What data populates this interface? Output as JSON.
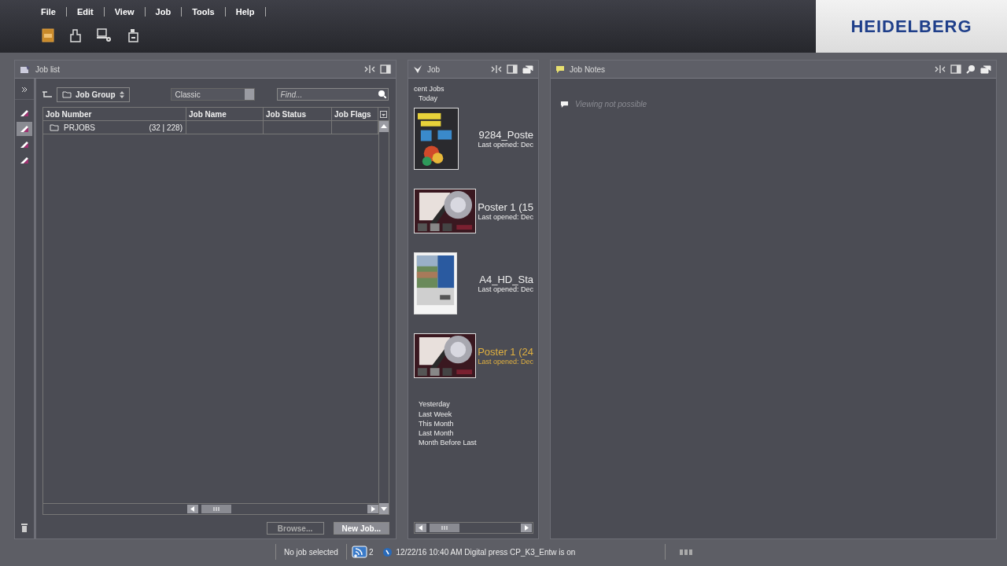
{
  "menu": [
    "File",
    "Edit",
    "View",
    "Job",
    "Tools",
    "Help"
  ],
  "logo": "HEIDELBERG",
  "job_list": {
    "title": "Job list",
    "group_selector": "Job Group",
    "view_mode": "Classic",
    "search": {
      "placeholder": "Find..."
    },
    "side_tools": [
      {
        "selected": false
      },
      {
        "selected": true
      },
      {
        "selected": false
      },
      {
        "selected": false
      }
    ],
    "columns": [
      "Job Number",
      "Job Name",
      "Job Status",
      "Job Flags"
    ],
    "rows": [
      {
        "name": "PRJOBS",
        "count": "(32 | 228)"
      }
    ],
    "buttons": [
      {
        "label": "Browse...",
        "disabled": true
      },
      {
        "label": "New Job...",
        "disabled": false
      }
    ]
  },
  "job_panel": {
    "title": "Job",
    "heading": "cent Jobs",
    "today": "Today",
    "jobs": [
      {
        "name": "9284_Poste",
        "opened": "Last opened: Dec",
        "selected": false
      },
      {
        "name": "Poster 1 (15",
        "opened": "Last opened: Dec",
        "selected": false
      },
      {
        "name": "A4_HD_Sta",
        "opened": "Last opened: Dec",
        "selected": false
      },
      {
        "name": "Poster 1 (24",
        "opened": "Last opened: Dec",
        "selected": true
      }
    ],
    "periods": [
      "Yesterday",
      "Last Week",
      "This Month",
      "Last Month",
      "Month Before Last"
    ]
  },
  "notes": {
    "title": "Job Notes",
    "message": "Viewing not possible"
  },
  "status_bar": {
    "selection": "No job selected",
    "notifications": "2",
    "message": "12/22/16 10:40 AM  Digital press CP_K3_Entw is on"
  }
}
